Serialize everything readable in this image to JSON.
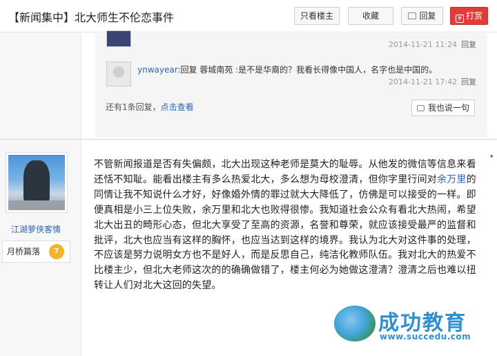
{
  "header": {
    "title": "【新闻集中】北大师生不伦恋事件",
    "only_author_label": "只看楼主",
    "favorite_label": "收藏",
    "reply_label": "回复",
    "tip_label": "打赏"
  },
  "sub_replies": {
    "items": [
      {
        "timestamp": "2014-11-21 11:24",
        "reply_link": "回复"
      },
      {
        "username": "ynwayear",
        "text": ":回复 蓉城南苑 :是不是华裔的？我看长得像中国人，名字也是中国的。",
        "timestamp": "2014-11-21 17:42",
        "reply_link": "回复"
      }
    ],
    "more_prefix": "还有1条回复，",
    "more_link": "点击查看",
    "say_button": "我也说一句"
  },
  "post": {
    "author": "江湖萝侠客情",
    "badge_label": "月桥篇落",
    "badge_level": "7",
    "content_part1": "不管新闻报道是否有失偏颇，北大出现这种老师是莫大的耻辱。从他发的微信等信息来看还恬不知耻。能看出楼主有多么热爱北大，多么想为母校澄清，但你字里行间对",
    "content_link": "余万里",
    "content_part2": "的同情让我不知说什么才好，好像婚外情的罪过就大大降低了，仿佛是可以接受的一样。即便真相是小三上位失败，余万里和北大也败得很惨。我知道社会公众有看北大热闹，希望北大出丑的畸形心态，但北大享受了至高的资源，名誉和尊荣，就应该接受最严的监督和批评，北大也应当有这样的胸怀，也应当达到这样的境界。我认为北大对这件事的处理，不应该是努力说明女方也不是好人，而是反思自己，纯洁化教师队伍。我对北大的热爱不比楼主少，但北大老师这次的的确确做错了，楼主何必为她做这澄清？澄清之后也难以扭转让人们对北大这回的失望。"
  },
  "watermark": {
    "brand": "成功教育",
    "url": "www.succedu.com"
  }
}
